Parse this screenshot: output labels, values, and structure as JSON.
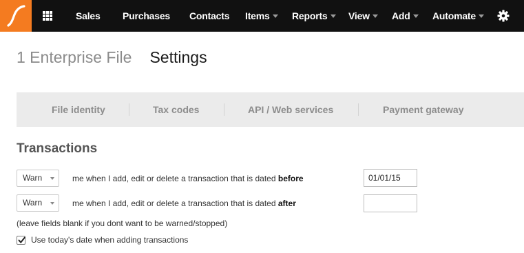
{
  "nav": {
    "logo": "myob-logo-icon",
    "apps_icon": "grid-icon",
    "items": [
      {
        "label": "Sales",
        "has_caret": false
      },
      {
        "label": "Purchases",
        "has_caret": false
      },
      {
        "label": "Contacts",
        "has_caret": false
      },
      {
        "label": "Items",
        "has_caret": true
      },
      {
        "label": "Reports",
        "has_caret": true
      },
      {
        "label": "View",
        "has_caret": true
      },
      {
        "label": "Add",
        "has_caret": true
      },
      {
        "label": "Automate",
        "has_caret": true
      }
    ],
    "settings_icon": "gear-icon"
  },
  "header": {
    "file_name": "1 Enterprise File",
    "page_title": "Settings"
  },
  "tabs": [
    {
      "label": "File identity"
    },
    {
      "label": "Tax codes"
    },
    {
      "label": "API / Web services"
    },
    {
      "label": "Payment gateway"
    }
  ],
  "transactions": {
    "title": "Transactions",
    "rules": [
      {
        "select_value": "Warn",
        "text": "me when I add, edit or delete a transaction that is dated ",
        "bold": "before",
        "date_value": "01/01/15"
      },
      {
        "select_value": "Warn",
        "text": "me when I add, edit or delete a transaction that is dated ",
        "bold": "after",
        "date_value": ""
      }
    ],
    "hint": "(leave fields blank if you dont want to be warned/stopped)",
    "checkbox": {
      "label": "Use today's date when adding transactions",
      "checked": true
    }
  },
  "colors": {
    "nav_bg": "#111111",
    "brand_orange": "#f47b20",
    "tabs_bg": "#ebebeb"
  }
}
